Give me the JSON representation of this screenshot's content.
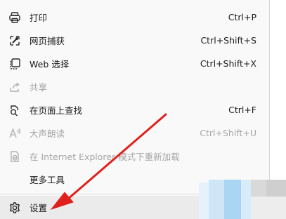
{
  "menu": {
    "items": [
      {
        "label": "打印",
        "shortcut": "Ctrl+P",
        "icon": "printer-icon",
        "disabled": false
      },
      {
        "label": "网页捕获",
        "shortcut": "Ctrl+Shift+S",
        "icon": "web-capture-icon",
        "disabled": false
      },
      {
        "label": "Web 选择",
        "shortcut": "Ctrl+Shift+X",
        "icon": "web-select-icon",
        "disabled": false
      },
      {
        "label": "共享",
        "shortcut": "",
        "icon": "share-icon",
        "disabled": true
      },
      {
        "label": "在页面上查找",
        "shortcut": "Ctrl+F",
        "icon": "find-on-page-icon",
        "disabled": false
      },
      {
        "label": "大声朗读",
        "shortcut": "Ctrl+Shift+U",
        "icon": "read-aloud-icon",
        "disabled": true
      },
      {
        "label": "在 Internet Explorer 模式下重新加载",
        "shortcut": "",
        "icon": "ie-mode-icon",
        "disabled": true
      },
      {
        "label": "更多工具",
        "shortcut": "",
        "icon": "",
        "disabled": false
      },
      {
        "label": "设置",
        "shortcut": "",
        "icon": "gear-icon",
        "disabled": false
      }
    ]
  },
  "colors": {
    "menu_bg": "#f9f9f9",
    "hover_bg": "#ebebeb",
    "disabled_text": "#a6a6a6",
    "annotation_arrow": "#e0201c"
  }
}
